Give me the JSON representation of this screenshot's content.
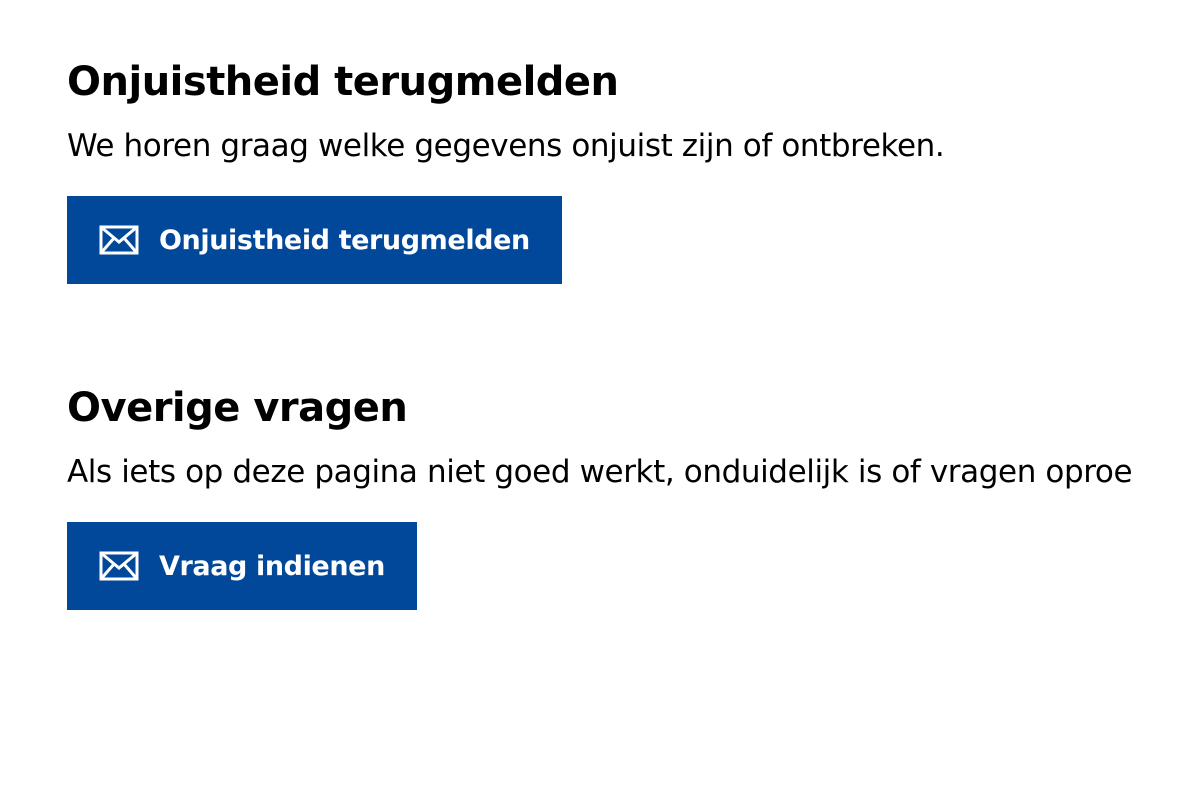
{
  "sections": [
    {
      "heading": "Onjuistheid terugmelden",
      "text": "We horen graag welke gegevens onjuist zijn of ontbreken.",
      "button": {
        "label": "Onjuistheid terugmelden",
        "icon": "mail-icon"
      }
    },
    {
      "heading": "Overige vragen",
      "text": "Als iets op deze pagina niet goed werkt, onduidelijk is of vragen oproe",
      "button": {
        "label": "Vraag indienen",
        "icon": "mail-icon"
      }
    }
  ],
  "colors": {
    "button_background": "#01489a",
    "button_text": "#ffffff",
    "text": "#000000",
    "background": "#ffffff"
  }
}
